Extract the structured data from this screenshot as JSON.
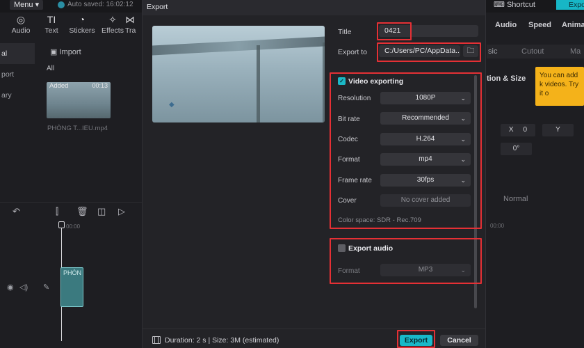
{
  "background": {
    "menu_label": "Menu",
    "autosave": "Auto saved: 16:02:12",
    "tools": [
      {
        "label": "Audio",
        "icon": "audio-icon"
      },
      {
        "label": "Text",
        "icon": "text-icon"
      },
      {
        "label": "Stickers",
        "icon": "stickers-icon"
      },
      {
        "label": "Effects",
        "icon": "effects-icon"
      },
      {
        "label": "Tra",
        "icon": "transitions-icon"
      }
    ],
    "left_nav": [
      "al",
      "port",
      "ary"
    ],
    "import_label": "Import",
    "all_label": "All",
    "media": {
      "badge": "Added",
      "duration": "00:13",
      "name": "PHÒNG T...IEU.mp4"
    },
    "shortcut_label": "Shortcut",
    "export_top_label": "Expo",
    "right_tabs": [
      "Audio",
      "Speed",
      "Anima"
    ],
    "right_subtabs": [
      "sic",
      "Cutout",
      "Ma"
    ],
    "section_pos": "tion & Size",
    "tooltip_text": "You can add k videos. Try it o",
    "pos_x_label": "X",
    "pos_x_value": "0",
    "pos_y_label": "Y",
    "rotate_value": "0°",
    "blend_value": "Normal",
    "track_clip_label": "PHÒN",
    "ruler_left": "00:00",
    "ruler_right": "00:00"
  },
  "dialog": {
    "title": "Export",
    "fields": {
      "title_label": "Title",
      "title_value": "0421",
      "export_to_label": "Export to",
      "export_to_value": "C:/Users/PC/AppData..."
    },
    "video": {
      "heading": "Video exporting",
      "checked": true,
      "settings": [
        {
          "label": "Resolution",
          "value": "1080P"
        },
        {
          "label": "Bit rate",
          "value": "Recommended"
        },
        {
          "label": "Codec",
          "value": "H.264"
        },
        {
          "label": "Format",
          "value": "mp4"
        },
        {
          "label": "Frame rate",
          "value": "30fps"
        }
      ],
      "cover_label": "Cover",
      "cover_value": "No cover added",
      "color_space": "Color space: SDR - Rec.709"
    },
    "audio": {
      "heading": "Export audio",
      "checked": false,
      "format_label": "Format",
      "format_value": "MP3"
    },
    "footer": {
      "duration_text": "Duration: 2 s | Size: 3M (estimated)",
      "export_label": "Export",
      "cancel_label": "Cancel"
    }
  },
  "colors": {
    "accent": "#19b9c8",
    "highlight": "#e53035",
    "dialog_bg": "#232327"
  }
}
